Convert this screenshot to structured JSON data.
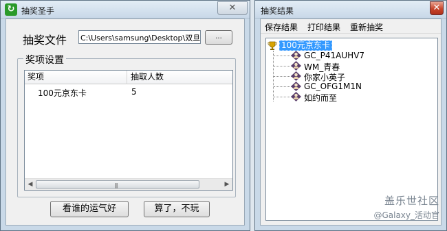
{
  "windows": {
    "main": {
      "title": "抽奖圣手",
      "app_icon": "lottery-app-icon",
      "file_label": "抽奖文件",
      "file_path": "C:\\Users\\samsung\\Desktop\\双旦活",
      "browse_label": "...",
      "group_title": "奖项设置",
      "columns": [
        "奖项",
        "抽取人数"
      ],
      "rows": [
        {
          "prize": "100元京东卡",
          "count": "5"
        }
      ],
      "buttons": {
        "lucky": "看谁的运气好",
        "quit": "算了，不玩"
      }
    },
    "results": {
      "title": "抽奖结果",
      "menu": [
        "保存结果",
        "打印结果",
        "重新抽奖"
      ],
      "tree_root": "100元京东卡",
      "root_icon": "trophy-icon",
      "item_icon": "user-icon",
      "winners": [
        "GC_P41AUHV7",
        "WM_青春",
        "你家小英子",
        "GC_OFG1M1N",
        "如约而至"
      ]
    }
  },
  "watermark": {
    "line1": "盖乐世社区",
    "line2": "@Galaxy_活动官"
  },
  "colors": {
    "selection": "#3399ff",
    "close_red": "#c7452c",
    "app_icon_green": "#2a9a2a"
  }
}
